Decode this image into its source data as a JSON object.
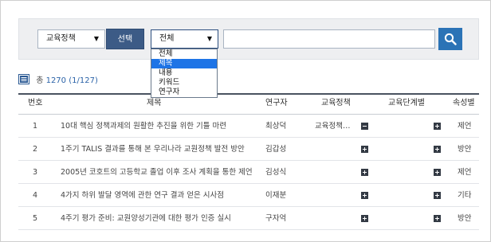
{
  "search": {
    "category_value": "교육정책",
    "select_button": "선택",
    "field_value": "전체",
    "field_options": [
      "전체",
      "제목",
      "내용",
      "키워드",
      "연구자"
    ],
    "selected_option_index": 1,
    "query_value": ""
  },
  "summary": {
    "prefix": "총",
    "total": "1270",
    "pages": "(1/127)"
  },
  "table": {
    "headers": [
      "번호",
      "제목",
      "연구자",
      "교육정책",
      "교육단계별",
      "속성별"
    ],
    "rows": [
      {
        "num": "1",
        "title": "10대 핵심 정책과제의 원활한 추진을 위한 기틀 마련",
        "researcher": "최상덕",
        "policy": "교육정책…",
        "policy_toggle": "minus",
        "stage_toggle": "plus",
        "attribute": "제언"
      },
      {
        "num": "2",
        "title": "1주기 TALIS 결과를 통해 본 우리나라 교원정책 발전 방안",
        "researcher": "김갑성",
        "policy": "",
        "policy_toggle": "plus",
        "stage_toggle": "plus",
        "attribute": "방안"
      },
      {
        "num": "3",
        "title": "2005년 코호트의 고등학교 졸업 이후 조사 계획을 통한 제언",
        "researcher": "김성식",
        "policy": "",
        "policy_toggle": "plus",
        "stage_toggle": "plus",
        "attribute": "제언"
      },
      {
        "num": "4",
        "title": "4가지 하위 발달 영역에 관한 연구 결과 얻은 시사점",
        "researcher": "이재분",
        "policy": "",
        "policy_toggle": "plus",
        "stage_toggle": "plus",
        "attribute": "기타"
      },
      {
        "num": "5",
        "title": "4주기 평가 준비: 교원양성기관에 대한 평가 인증 실시",
        "researcher": "구자억",
        "policy": "",
        "policy_toggle": "plus",
        "stage_toggle": "plus",
        "attribute": "방안"
      }
    ]
  },
  "colors": {
    "select_button_bg": "#3c5b86",
    "search_button_bg": "#2b73b6",
    "dropdown_highlight": "#1e74e6",
    "count_number": "#2b63a8"
  },
  "icons": {
    "search": "magnifier-icon",
    "list": "list-icon",
    "expand": "plus-square-icon",
    "collapse": "minus-square-icon"
  }
}
